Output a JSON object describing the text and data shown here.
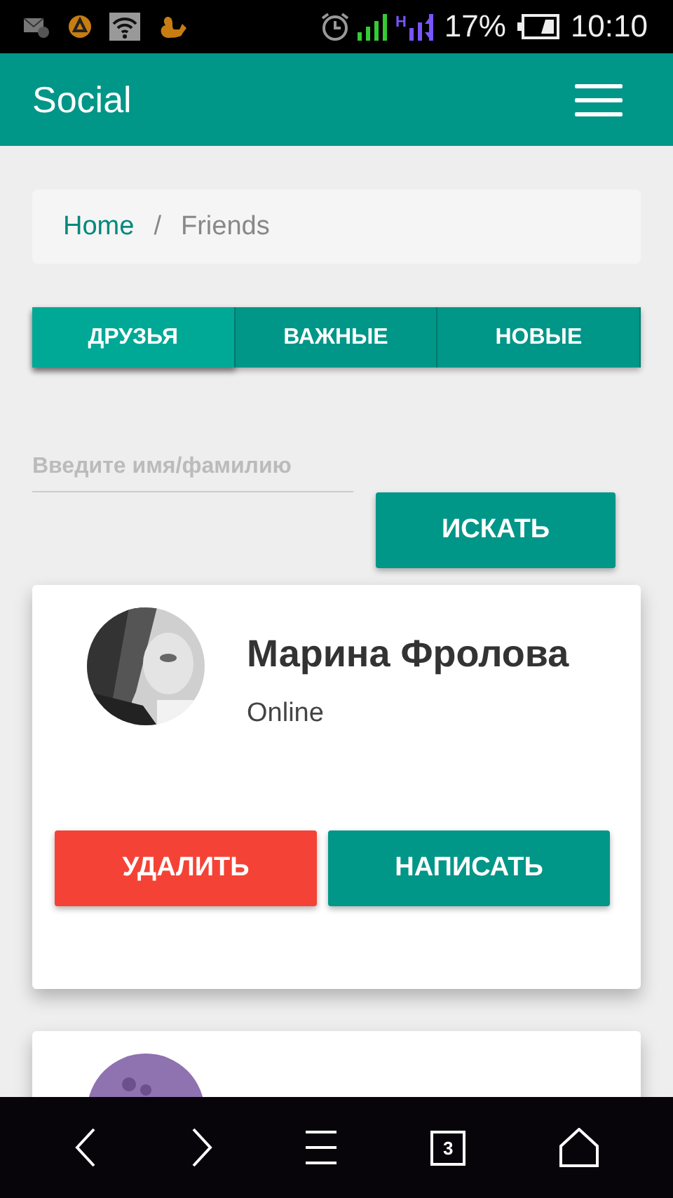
{
  "status_bar": {
    "network_type": "H",
    "battery": "17%",
    "time": "10:10"
  },
  "header": {
    "title": "Social"
  },
  "breadcrumb": [
    {
      "label": "Home",
      "kind": "link"
    },
    {
      "label": "/",
      "kind": "separator"
    },
    {
      "label": "Friends",
      "kind": "current"
    }
  ],
  "tabs": [
    {
      "label": "ДРУЗЬЯ",
      "selected": true
    },
    {
      "label": "ВАЖНЫЕ",
      "selected": false
    },
    {
      "label": "НОВЫЕ",
      "selected": false
    }
  ],
  "search": {
    "placeholder": "Введите имя/фамилию",
    "button": "ИСКАТЬ"
  },
  "friends": [
    {
      "name": "Марина Фролова",
      "status": "Online",
      "avatar": {
        "kind": "picture"
      },
      "actions": [
        {
          "label": "УДАЛИТЬ",
          "kind": "danger"
        },
        {
          "label": "НАПИСАТЬ",
          "kind": "primary"
        }
      ]
    },
    {
      "avatar": {
        "kind": "picture"
      }
    }
  ],
  "nav_bar": {
    "tabs_count": "3"
  }
}
